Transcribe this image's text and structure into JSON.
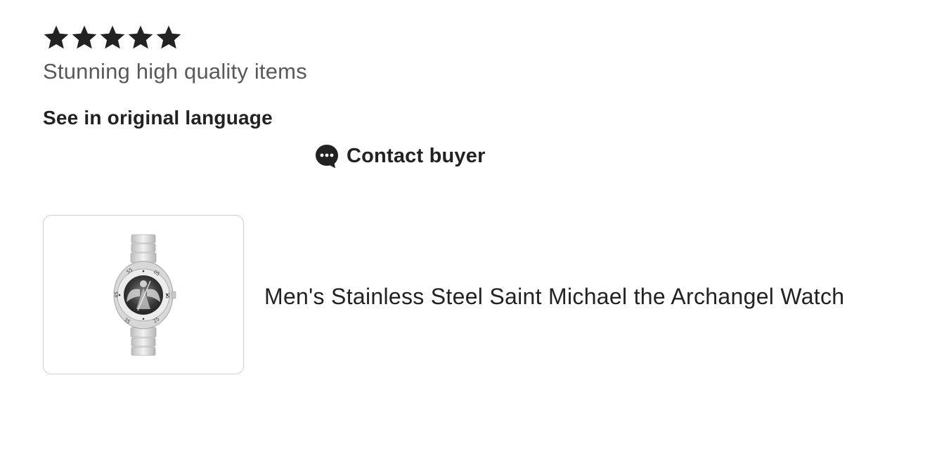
{
  "review": {
    "rating": 5,
    "max_rating": 5,
    "star_icon": "star-icon",
    "text": "Stunning high quality items"
  },
  "actions": {
    "see_original_label": "See in original language",
    "contact_buyer_label": "Contact buyer",
    "contact_icon": "chat-bubble-icon"
  },
  "item": {
    "title": "Men's Stainless Steel Saint Michael the Archangel Watch",
    "image_icon": "watch-image"
  },
  "colors": {
    "text_primary": "#222222",
    "text_secondary": "#595959",
    "card_border": "#cfcfcf"
  }
}
